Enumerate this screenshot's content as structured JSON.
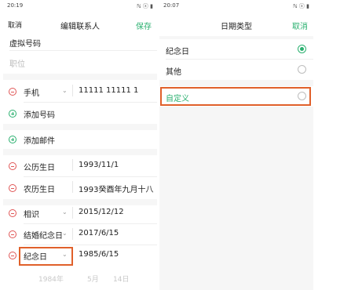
{
  "left": {
    "status_time": "20:19",
    "status_icons": "ℕ ⓧ ▮",
    "nav": {
      "cancel": "取消",
      "title": "编辑联系人",
      "save": "保存"
    },
    "virtual_number": "虚拟号码",
    "job_placeholder": "职位",
    "phone": {
      "label": "手机",
      "value": "11111 11111 1"
    },
    "add_phone": "添加号码",
    "add_email": "添加邮件",
    "dates": [
      {
        "label": "公历生日",
        "value": "1993/11/1"
      },
      {
        "label": "农历生日",
        "value": "1993癸酉年九月十八"
      },
      {
        "label": "相识",
        "value": "2015/12/12"
      },
      {
        "label": "结婚纪念日",
        "value": "2017/6/15"
      },
      {
        "label": "纪念日",
        "value": "1985/6/15"
      }
    ],
    "picker": {
      "year": "1984年",
      "month": "5月",
      "day": "14日"
    }
  },
  "right": {
    "status_time": "20:07",
    "status_icons": "ℕ ⓧ ▮",
    "nav": {
      "title": "日期类型",
      "cancel": "取消"
    },
    "options": [
      {
        "label": "纪念日",
        "selected": true
      },
      {
        "label": "其他",
        "selected": false
      },
      {
        "label": "自定义",
        "selected": false
      }
    ]
  },
  "colors": {
    "accent": "#2ab06f",
    "remove": "#e05555",
    "highlight": "#e0602a"
  }
}
